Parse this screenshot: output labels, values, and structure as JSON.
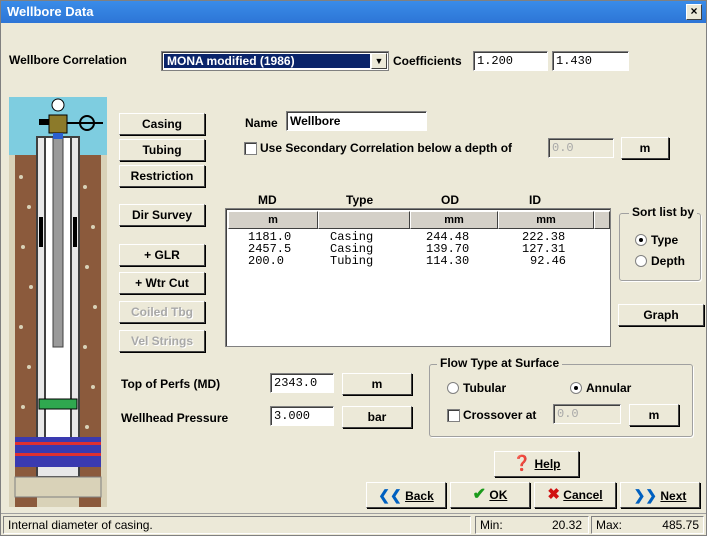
{
  "window": {
    "title": "Wellbore Data",
    "close_label": "×"
  },
  "correlation": {
    "label": "Wellbore Correlation",
    "selected": "MONA modified (1986)",
    "coefficients_label": "Coefficients",
    "coef1": "1.200",
    "coef2": "1.430"
  },
  "left_buttons": {
    "casing": "Casing",
    "tubing": "Tubing",
    "restriction": "Restriction",
    "dir_survey": "Dir Survey",
    "glr": "+ GLR",
    "wtr_cut": "+ Wtr Cut",
    "coiled_tbg": "Coiled Tbg",
    "vel_strings": "Vel Strings"
  },
  "name": {
    "label": "Name",
    "value": "Wellbore"
  },
  "secondary": {
    "label": "Use Secondary Correlation below a depth of",
    "value": "0.0",
    "unit": "m"
  },
  "table": {
    "headers": [
      "MD",
      "Type",
      "OD",
      "ID"
    ],
    "units": [
      "m",
      "",
      "mm",
      "mm"
    ],
    "rows": [
      [
        "1181.0",
        "Casing",
        "244.48",
        "222.38"
      ],
      [
        "2457.5",
        "Casing",
        "139.70",
        "127.31"
      ],
      [
        "200.0",
        "Tubing",
        "114.30",
        "92.46"
      ]
    ]
  },
  "sort": {
    "title": "Sort list by",
    "type_label": "Type",
    "depth_label": "Depth",
    "selected": "Type"
  },
  "graph_label": "Graph",
  "top_perfs": {
    "label": "Top of Perfs (MD)",
    "value": "2343.0",
    "unit": "m"
  },
  "wellhead": {
    "label": "Wellhead Pressure",
    "value": "3.000",
    "unit": "bar"
  },
  "flow_type": {
    "title": "Flow Type at Surface",
    "tubular": "Tubular",
    "annular": "Annular",
    "selected": "Annular",
    "crossover_label": "Crossover at",
    "crossover_value": "0.0",
    "crossover_unit": "m"
  },
  "actions": {
    "help": "Help",
    "back": "Back",
    "ok": "OK",
    "cancel": "Cancel",
    "next": "Next"
  },
  "status": {
    "text": "Internal diameter of casing.",
    "min_label": "Min:",
    "min_value": "20.32",
    "max_label": "Max:",
    "max_value": "485.75"
  },
  "colors": {
    "title_bar": "#2d75d6",
    "highlight": "#0a246a",
    "casing_ground": "#8b5a3c"
  }
}
